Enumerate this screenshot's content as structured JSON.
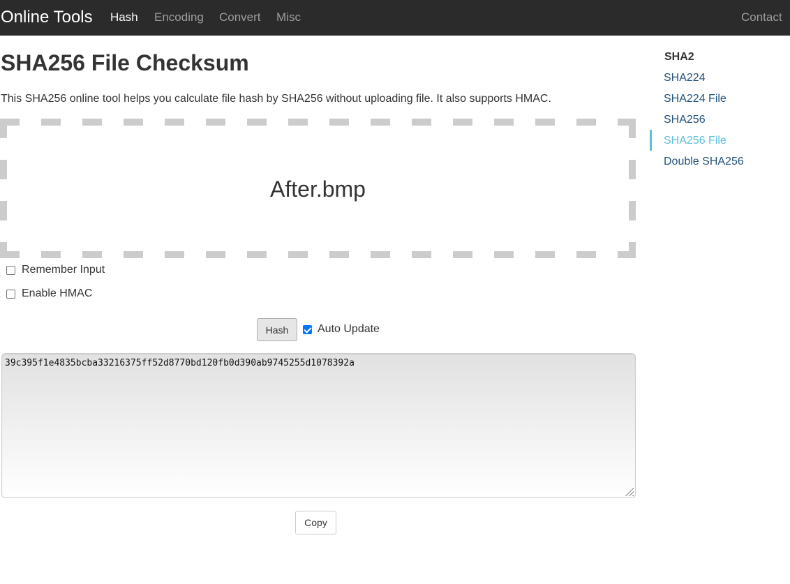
{
  "navbar": {
    "brand": "Online Tools",
    "links": [
      {
        "label": "Hash",
        "active": true
      },
      {
        "label": "Encoding",
        "active": false
      },
      {
        "label": "Convert",
        "active": false
      },
      {
        "label": "Misc",
        "active": false
      }
    ],
    "contact": "Contact"
  },
  "main": {
    "title": "SHA256 File Checksum",
    "description": "This SHA256 online tool helps you calculate file hash by SHA256 without uploading file. It also supports HMAC.",
    "file_name": "After.bmp",
    "options": {
      "remember_input": {
        "label": "Remember Input",
        "checked": false
      },
      "enable_hmac": {
        "label": "Enable HMAC",
        "checked": false
      },
      "auto_update": {
        "label": "Auto Update",
        "checked": true
      }
    },
    "hash_button": "Hash",
    "output": "39c395f1e4835bcba33216375ff52d8770bd120fb0d390ab9745255d1078392a",
    "copy_button": "Copy"
  },
  "sidebar": {
    "heading": "SHA2",
    "items": [
      {
        "label": "SHA224",
        "active": false
      },
      {
        "label": "SHA224 File",
        "active": false
      },
      {
        "label": "SHA256",
        "active": false
      },
      {
        "label": "SHA256 File",
        "active": true
      },
      {
        "label": "Double SHA256",
        "active": false
      }
    ]
  },
  "colors": {
    "navbar_bg": "#2b2b2b",
    "link": "#23527c",
    "active_link": "#5bc0de",
    "checkbox_accent": "#0075ff"
  }
}
